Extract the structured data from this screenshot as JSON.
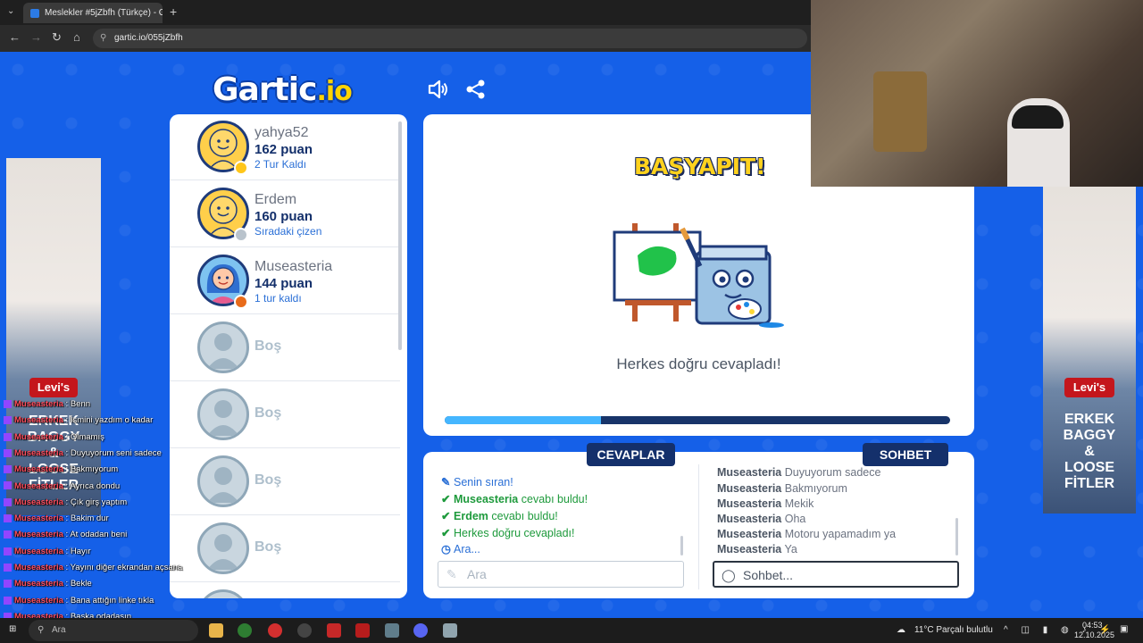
{
  "browser": {
    "tab_title": "Meslekler #5jZbfh (Türkçe) - Ga",
    "url": "gartic.io/055jZbfh"
  },
  "game": {
    "logo_main": "Gartic",
    "logo_suffix": ".io",
    "masterpiece": "BAŞYAPIT!",
    "message": "Herkes doğru cevapladı!",
    "progress_percent": 31
  },
  "players": [
    {
      "name": "yahya52",
      "score": "162 puan",
      "status": "2 Tur Kaldı",
      "badge": "#ffc61a"
    },
    {
      "name": "Erdem",
      "score": "160 puan",
      "status": "Sıradaki çizen",
      "badge": "#b9c3cc"
    },
    {
      "name": "Museasteria",
      "score": "144 puan",
      "status": "1 tur kaldı",
      "badge": "#e86b1a"
    },
    {
      "name": "Boş"
    },
    {
      "name": "Boş"
    },
    {
      "name": "Boş"
    },
    {
      "name": "Boş"
    }
  ],
  "answers": {
    "tab_label": "CEVAPLAR",
    "lines": [
      {
        "text": "Senin sıran!"
      },
      {
        "user": "Museasteria",
        "text": "cevabı buldu!"
      },
      {
        "user": "Erdem",
        "text": "cevabı buldu!"
      },
      {
        "text": "Herkes doğru cevapladı!"
      },
      {
        "text": "Ara..."
      }
    ],
    "input_placeholder": "Ara"
  },
  "chat": {
    "tab_label": "SOHBET",
    "lines": [
      {
        "user": "Museasteria",
        "text": "Duyuyorum sadece"
      },
      {
        "user": "Museasteria",
        "text": "Bakmıyorum"
      },
      {
        "user": "Museasteria",
        "text": "Mekik"
      },
      {
        "user": "Museasteria",
        "text": "Oha"
      },
      {
        "user": "Museasteria",
        "text": "Motoru yapamadım ya"
      },
      {
        "user": "Museasteria",
        "text": "Ya"
      }
    ],
    "input_placeholder": "Sohbet..."
  },
  "ads": {
    "brand": "Levi's",
    "text": [
      "ERKEK",
      "BAGGY",
      "&",
      "LOOSE",
      "FİTLER"
    ]
  },
  "stream_chat": [
    {
      "user": "Museasteria",
      "text": "Benn"
    },
    {
      "user": "Museasteria",
      "text": "İsmini yazdım o kadar"
    },
    {
      "user": "Museasteria",
      "text": "Olmamış"
    },
    {
      "user": "Museasteria",
      "text": "Duyuyorum seni sadece"
    },
    {
      "user": "Museasteria",
      "text": "Bakmıyorum"
    },
    {
      "user": "Museasteria",
      "text": "Ayrıca dondu"
    },
    {
      "user": "Museasteria",
      "text": "Çık girş yaptım"
    },
    {
      "user": "Museasteria",
      "text": "Bakim dur"
    },
    {
      "user": "Museasteria",
      "text": "At odadan beni"
    },
    {
      "user": "Museasteria",
      "text": "Hayır"
    },
    {
      "user": "Museasteria",
      "text": "Yayını diğer ekrandan açsana"
    },
    {
      "user": "Museasteria",
      "text": "Bekle"
    },
    {
      "user": "Museasteria",
      "text": "Bana attığın linke tıkla"
    },
    {
      "user": "Museasteria",
      "text": "Başka odadasın"
    },
    {
      "user": "Museasteria",
      "text": "LİNK ALIM"
    }
  ],
  "taskbar": {
    "search_placeholder": "Ara",
    "weather": "11°C  Parçalı bulutlu",
    "time": "04:53",
    "date": "12.10.2025"
  }
}
